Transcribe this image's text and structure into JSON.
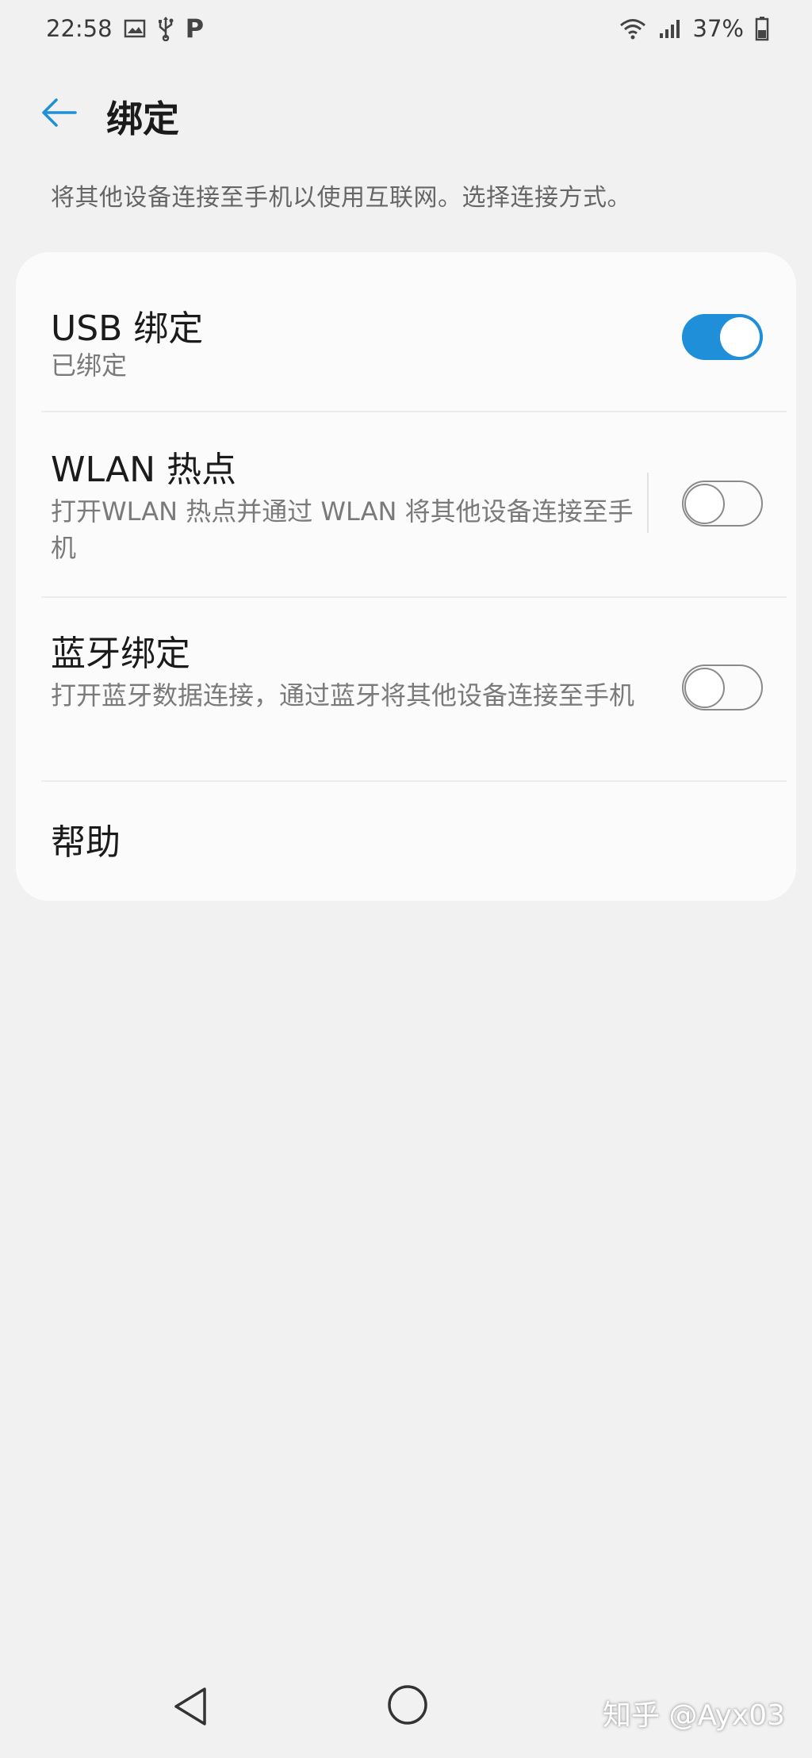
{
  "status_bar": {
    "time": "22:58",
    "battery": "37%",
    "left_icons": [
      "gallery-icon",
      "usb-icon",
      "p-icon"
    ],
    "right_icons": [
      "wifi-hotspot-icon",
      "signal-icon",
      "battery-icon"
    ],
    "p_glyph": "P"
  },
  "header": {
    "title": "绑定"
  },
  "description": "将其他设备连接至手机以使用互联网。选择连接方式。",
  "settings": {
    "usb": {
      "title": "USB 绑定",
      "subtitle": "已绑定",
      "enabled": true
    },
    "wlan": {
      "title": "WLAN 热点",
      "subtitle": "打开WLAN 热点并通过 WLAN 将其他设备连接至手机",
      "enabled": false
    },
    "bluetooth": {
      "title": "蓝牙绑定",
      "subtitle": "打开蓝牙数据连接，通过蓝牙将其他设备连接至手机",
      "enabled": false
    },
    "help": {
      "title": "帮助"
    }
  },
  "watermark": "知乎 @Ayx03",
  "colors": {
    "accent": "#1e8fd8",
    "background": "#f1f1f1",
    "card": "#fbfbfb"
  }
}
